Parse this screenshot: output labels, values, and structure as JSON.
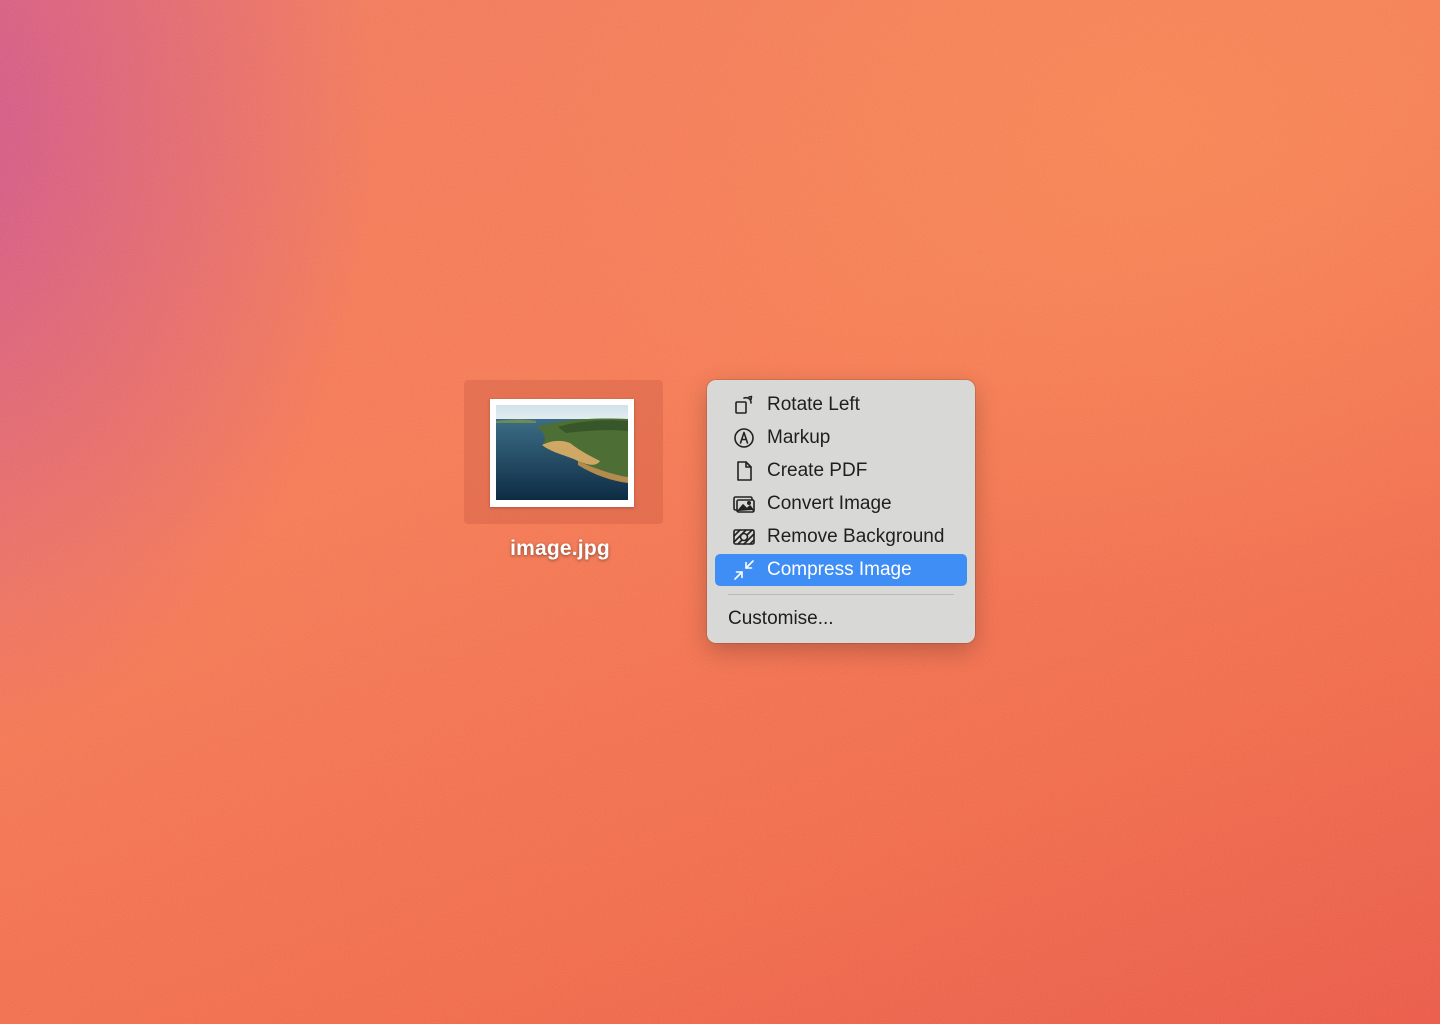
{
  "desktop": {
    "file": {
      "name": "image.jpg",
      "thumbnail_icon": "landscape-photo-thumbnail"
    }
  },
  "context_menu": {
    "items": [
      {
        "label": "Rotate Left",
        "icon": "rotate-left-icon"
      },
      {
        "label": "Markup",
        "icon": "markup-icon"
      },
      {
        "label": "Create PDF",
        "icon": "document-icon"
      },
      {
        "label": "Convert Image",
        "icon": "convert-image-icon"
      },
      {
        "label": "Remove Background",
        "icon": "remove-background-icon"
      },
      {
        "label": "Compress Image",
        "icon": "compress-icon",
        "selected": true
      }
    ],
    "footer_item": {
      "label": "Customise..."
    },
    "selected_color": "#3f8ef5"
  }
}
